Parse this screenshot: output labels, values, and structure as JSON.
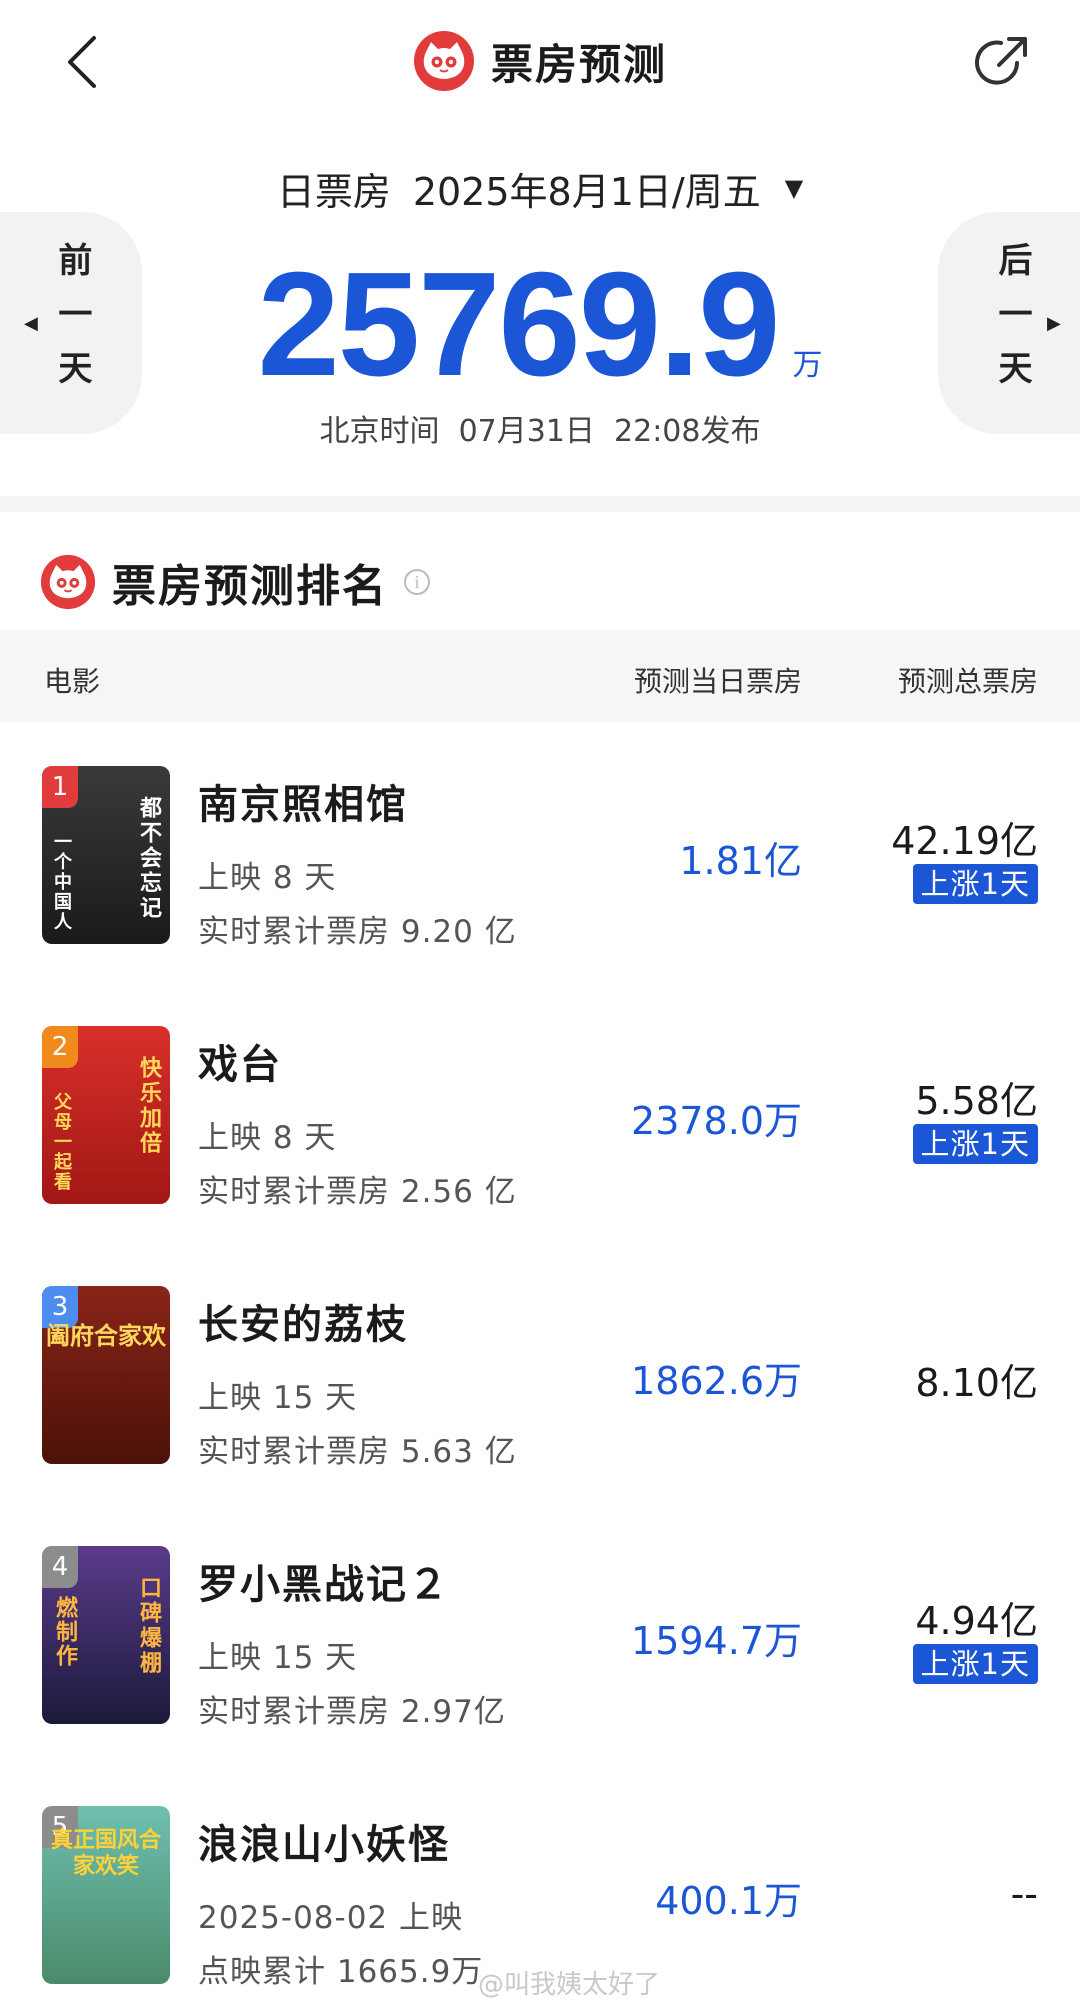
{
  "header": {
    "title": "票房预测"
  },
  "date_selector": {
    "label": "日票房",
    "date": "2025年8月1日/周五"
  },
  "nav": {
    "prev": "前一天",
    "next": "后一天"
  },
  "total": {
    "value": "25769.9",
    "unit": "万",
    "publish_prefix": "北京时间",
    "publish_date": "07月31日",
    "publish_time": "22:08发布"
  },
  "ranking": {
    "title": "票房预测排名",
    "columns": {
      "movie": "电影",
      "day": "预测当日票房",
      "total": "预测总票房"
    },
    "movies": [
      {
        "rank": "1",
        "name": "南京照相馆",
        "release": "上映 8 天",
        "cumulative": "实时累计票房 9.20 亿",
        "pred_day": "1.81亿",
        "pred_total": "42.19亿",
        "badge": "上涨1天",
        "poster_text": "都不会忘记",
        "poster_text_left": "一个中国人",
        "poster_colors": [
          "#3a3a3a",
          "#1a1a1a"
        ],
        "rank_color": "#e23b3b"
      },
      {
        "rank": "2",
        "name": "戏台",
        "release": "上映 8 天",
        "cumulative": "实时累计票房 2.56 亿",
        "pred_day": "2378.0万",
        "pred_total": "5.58亿",
        "badge": "上涨1天",
        "poster_text": "快乐加倍",
        "poster_text_left": "父母一起看",
        "poster_colors": [
          "#d8302a",
          "#a11714"
        ],
        "rank_color": "#f08a1c"
      },
      {
        "rank": "3",
        "name": "长安的荔枝",
        "release": "上映 15 天",
        "cumulative": "实时累计票房 5.63 亿",
        "pred_day": "1862.6万",
        "pred_total": "8.10亿",
        "badge": "",
        "poster_banner": "阖府合家欢",
        "poster_colors": [
          "#8a2418",
          "#4a1208"
        ],
        "rank_color": "#4d8df0"
      },
      {
        "rank": "4",
        "name": "罗小黑战记２",
        "release": "上映 15 天",
        "cumulative": "实时累计票房 2.97亿",
        "pred_day": "1594.7万",
        "pred_total": "4.94亿",
        "badge": "上涨1天",
        "poster_text": "口碑爆棚",
        "poster_text_left": "燃制作",
        "poster_colors": [
          "#5a3b8a",
          "#1a1a3a"
        ],
        "rank_color": "#8c8c8c"
      },
      {
        "rank": "5",
        "name": "浪浪山小妖怪",
        "release": "2025-08-02 上映",
        "cumulative": "点映累计 1665.9万",
        "pred_day": "400.1万",
        "pred_total": "--",
        "badge": "",
        "poster_banner": "真正国风合家欢笑",
        "poster_colors": [
          "#6fbfb0",
          "#4a8a6a"
        ],
        "rank_color": "#8c8c8c"
      }
    ]
  },
  "watermark": "@叫我姨太好了",
  "colors": {
    "accent": "#1a56d6",
    "brand": "#e23b3b"
  }
}
